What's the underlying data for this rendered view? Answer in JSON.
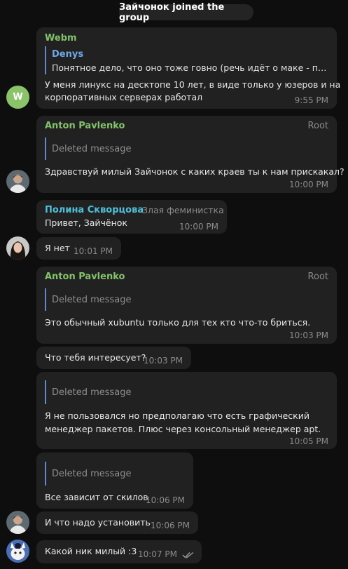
{
  "service_message": "Зайчонок joined the group",
  "colors": {
    "green_author": "#82c26b",
    "teal_author": "#4ebfda",
    "reply_accent": "#5c8dd4",
    "bubble_bg": "#212121",
    "background": "#0e0e0e"
  },
  "messages": [
    {
      "author": "Webm",
      "avatar_letter": "W",
      "reply_author": "Denys",
      "reply_text": "Понятное дело, что оно тоже говно (речь идёт о маке - прим....",
      "text_lines": [
        "У меня линукс на десктопе 10 лет, в виде только у юзеров и на",
        "корпоративных серверах работал"
      ],
      "time": "9:55 PM"
    },
    {
      "author": "Anton Pavlenko",
      "role": "Root",
      "reply_text": "Deleted message",
      "text": "Здравствуй милый Зайчонок с каких краев ты к нам прискакал?",
      "time": "10:00 PM"
    },
    {
      "author": "Полина Скворцова",
      "role": "Злая феминистка",
      "text": "Привет, Зайчёнок",
      "time": "10:00 PM"
    },
    {
      "text": "Я нет",
      "time": "10:01 PM"
    },
    {
      "author": "Anton Pavlenko",
      "role": "Root",
      "reply_text": "Deleted message",
      "text": "Это обычный xubuntu только для тех кто что-то бриться.",
      "time": "10:03 PM"
    },
    {
      "text": "Что тебя интересует?",
      "time": "10:03 PM"
    },
    {
      "reply_text": "Deleted message",
      "text_lines": [
        "Я не пользовался но предполагаю что есть графический",
        "менеджер пакетов. Плюс через консольный менеджер apt."
      ],
      "time": "10:05 PM"
    },
    {
      "reply_text": "Deleted message",
      "text": "Все зависит от скилов",
      "time": "10:06 PM"
    },
    {
      "text": "И что надо установить",
      "time": "10:06 PM"
    },
    {
      "text": "Какой ник милый :3",
      "time": "10:07 PM",
      "status_icon": "double-check-icon"
    }
  ]
}
